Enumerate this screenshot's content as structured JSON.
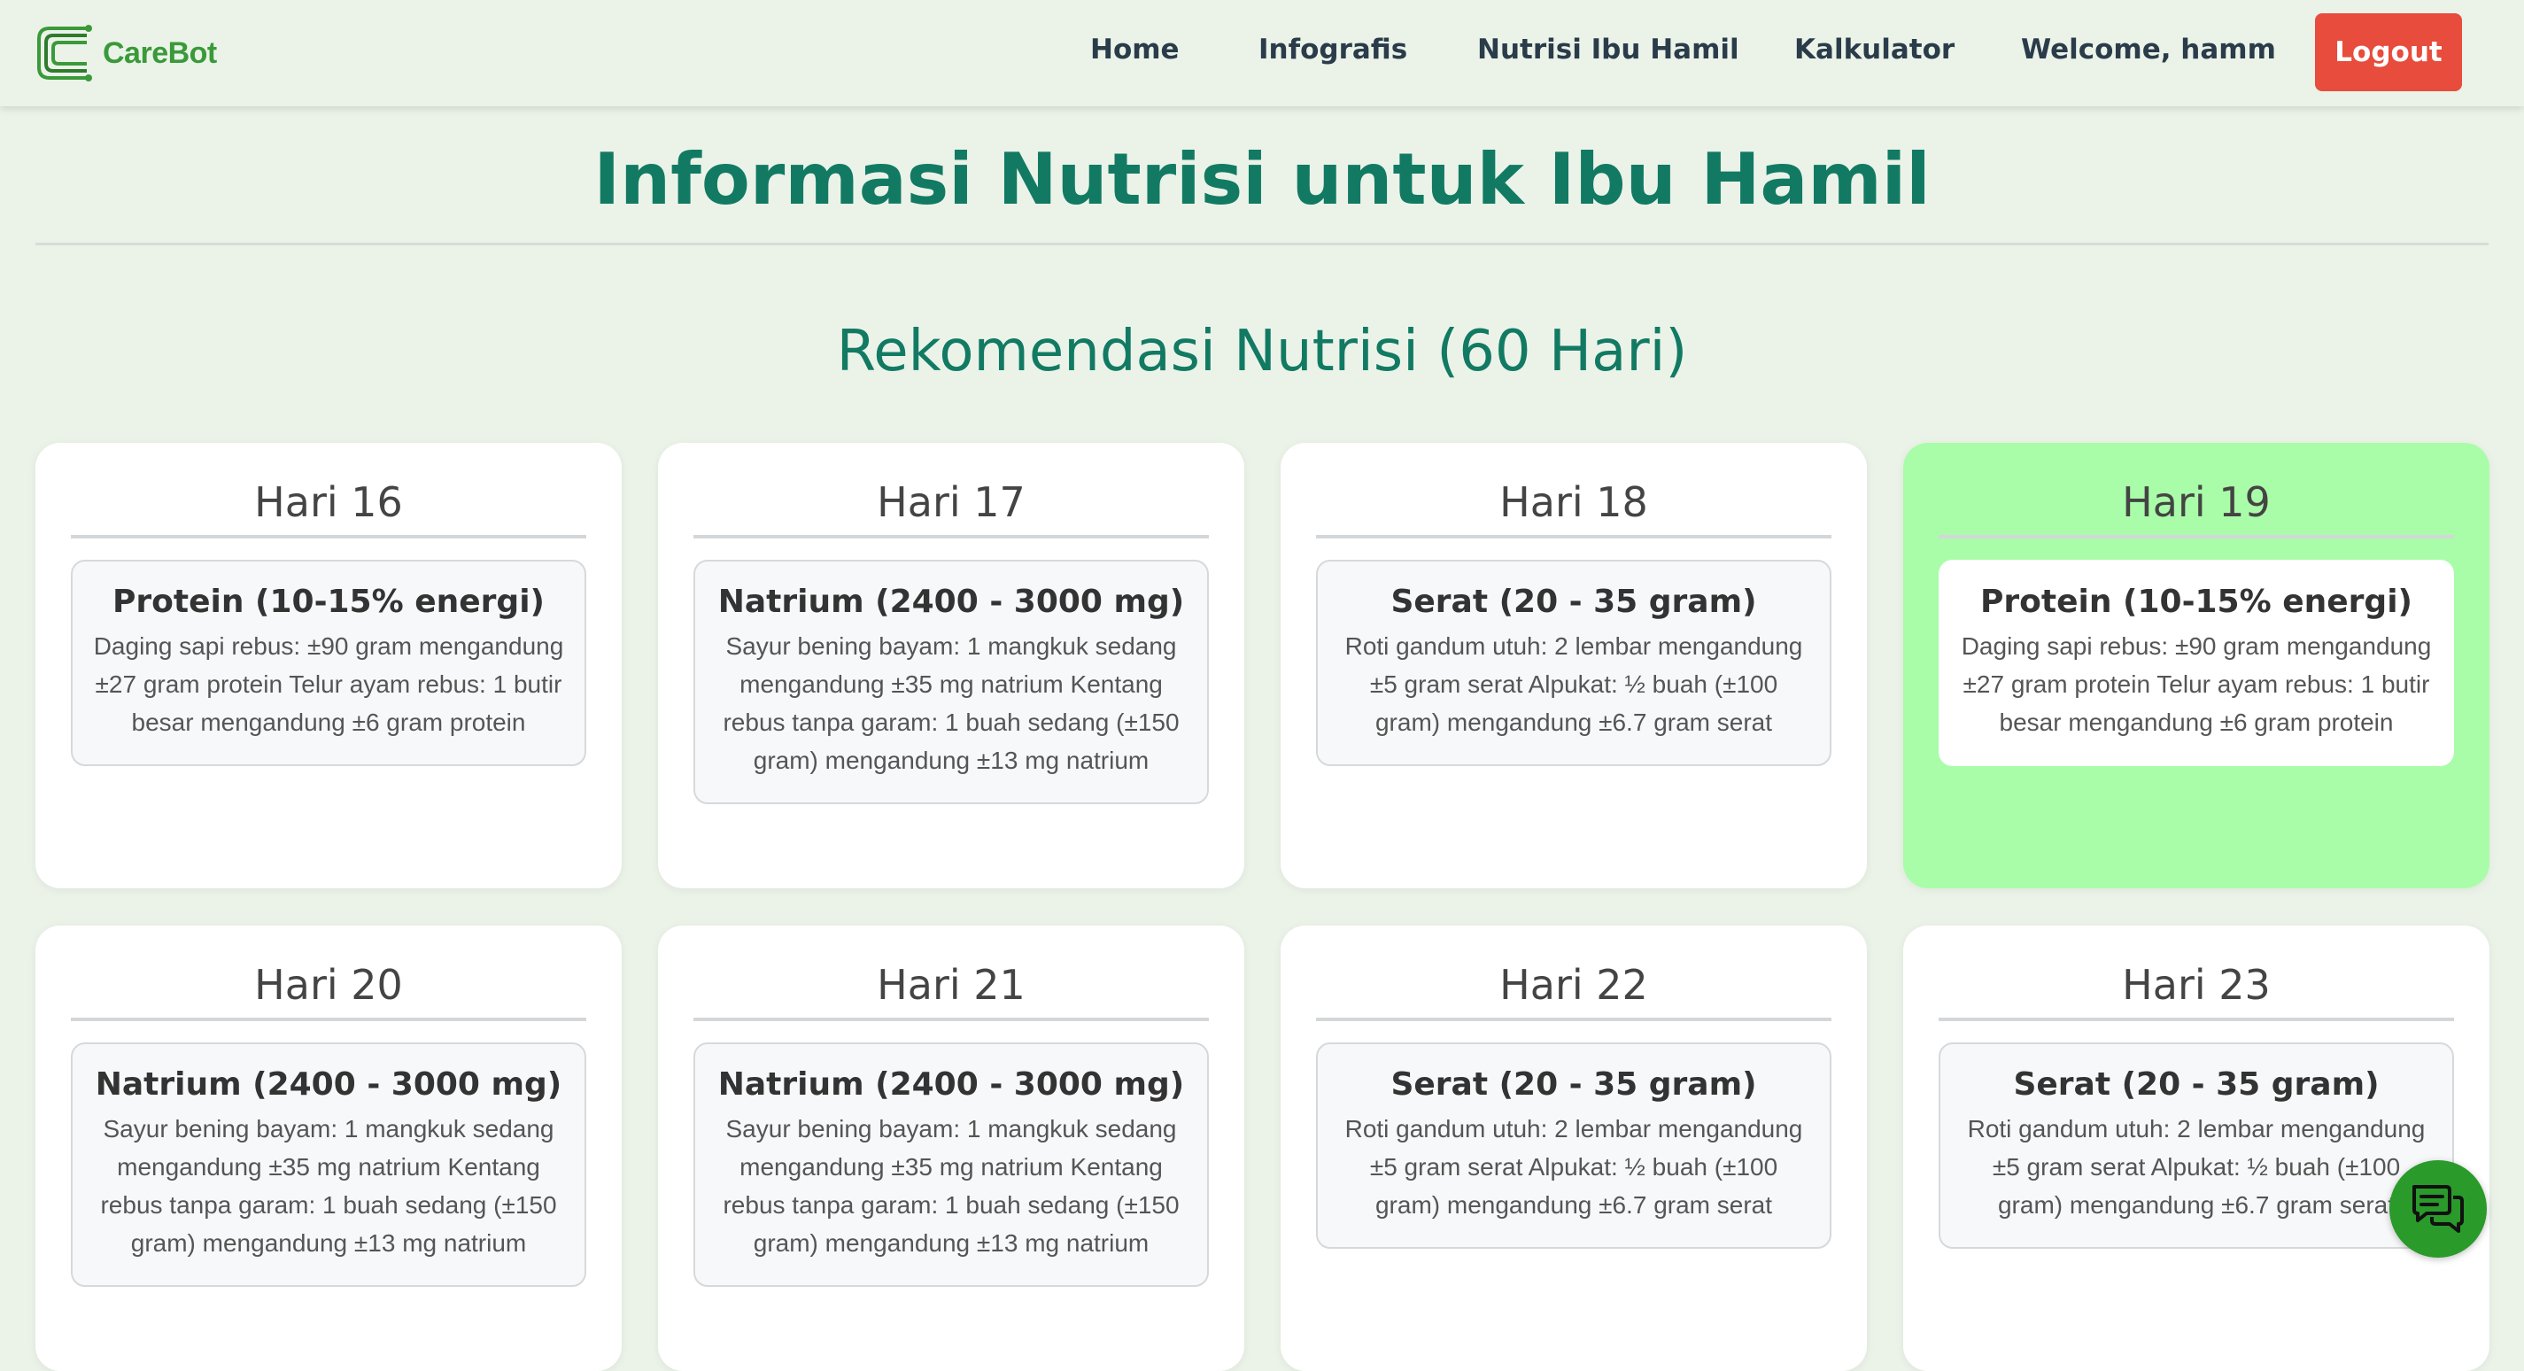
{
  "brand": {
    "name": "CareBot",
    "logo_color": "#3a9a3a"
  },
  "nav": {
    "home": "Home",
    "infografis": "Infografis",
    "nutrisi": "Nutrisi Ibu Hamil",
    "kalkulator": "Kalkulator",
    "welcome": "Welcome, hamm",
    "logout": "Logout"
  },
  "page": {
    "title": "Informasi Nutrisi untuk Ibu Hamil",
    "section_title": "Rekomendasi Nutrisi (60 Hari)"
  },
  "colors": {
    "accent": "#127a63",
    "logout": "#e74c3c",
    "active_card": "#a9fda8",
    "chat_button": "#2a9a2a",
    "background": "#ebf3e9"
  },
  "cards": [
    {
      "day": "Hari 16",
      "active": false,
      "nutrient": "Protein (10-15% energi)",
      "desc": "Daging sapi rebus: ±90 gram mengandung ±27 gram protein Telur ayam rebus: 1 butir besar mengandung ±6 gram protein"
    },
    {
      "day": "Hari 17",
      "active": false,
      "nutrient": "Natrium (2400 - 3000 mg)",
      "desc": "Sayur bening bayam: 1 mangkuk sedang mengandung ±35 mg natrium Kentang rebus tanpa garam: 1 buah sedang (±150 gram) mengandung ±13 mg natrium"
    },
    {
      "day": "Hari 18",
      "active": false,
      "nutrient": "Serat (20 - 35 gram)",
      "desc": "Roti gandum utuh: 2 lembar mengandung ±5 gram serat Alpukat: ½ buah (±100 gram) mengandung ±6.7 gram serat"
    },
    {
      "day": "Hari 19",
      "active": true,
      "nutrient": "Protein (10-15% energi)",
      "desc": "Daging sapi rebus: ±90 gram mengandung ±27 gram protein Telur ayam rebus: 1 butir besar mengandung ±6 gram protein"
    },
    {
      "day": "Hari 20",
      "active": false,
      "nutrient": "Natrium (2400 - 3000 mg)",
      "desc": "Sayur bening bayam: 1 mangkuk sedang mengandung ±35 mg natrium Kentang rebus tanpa garam: 1 buah sedang (±150 gram) mengandung ±13 mg natrium"
    },
    {
      "day": "Hari 21",
      "active": false,
      "nutrient": "Natrium (2400 - 3000 mg)",
      "desc": "Sayur bening bayam: 1 mangkuk sedang mengandung ±35 mg natrium Kentang rebus tanpa garam: 1 buah sedang (±150 gram) mengandung ±13 mg natrium"
    },
    {
      "day": "Hari 22",
      "active": false,
      "nutrient": "Serat (20 - 35 gram)",
      "desc": "Roti gandum utuh: 2 lembar mengandung ±5 gram serat Alpukat: ½ buah (±100 gram) mengandung ±6.7 gram serat"
    },
    {
      "day": "Hari 23",
      "active": false,
      "nutrient": "Serat (20 - 35 gram)",
      "desc": "Roti gandum utuh: 2 lembar mengandung ±5 gram serat Alpukat: ½ buah (±100 gram) mengandung ±6.7 gram serat"
    }
  ],
  "chat": {
    "icon": "chat-bubbles-icon"
  }
}
